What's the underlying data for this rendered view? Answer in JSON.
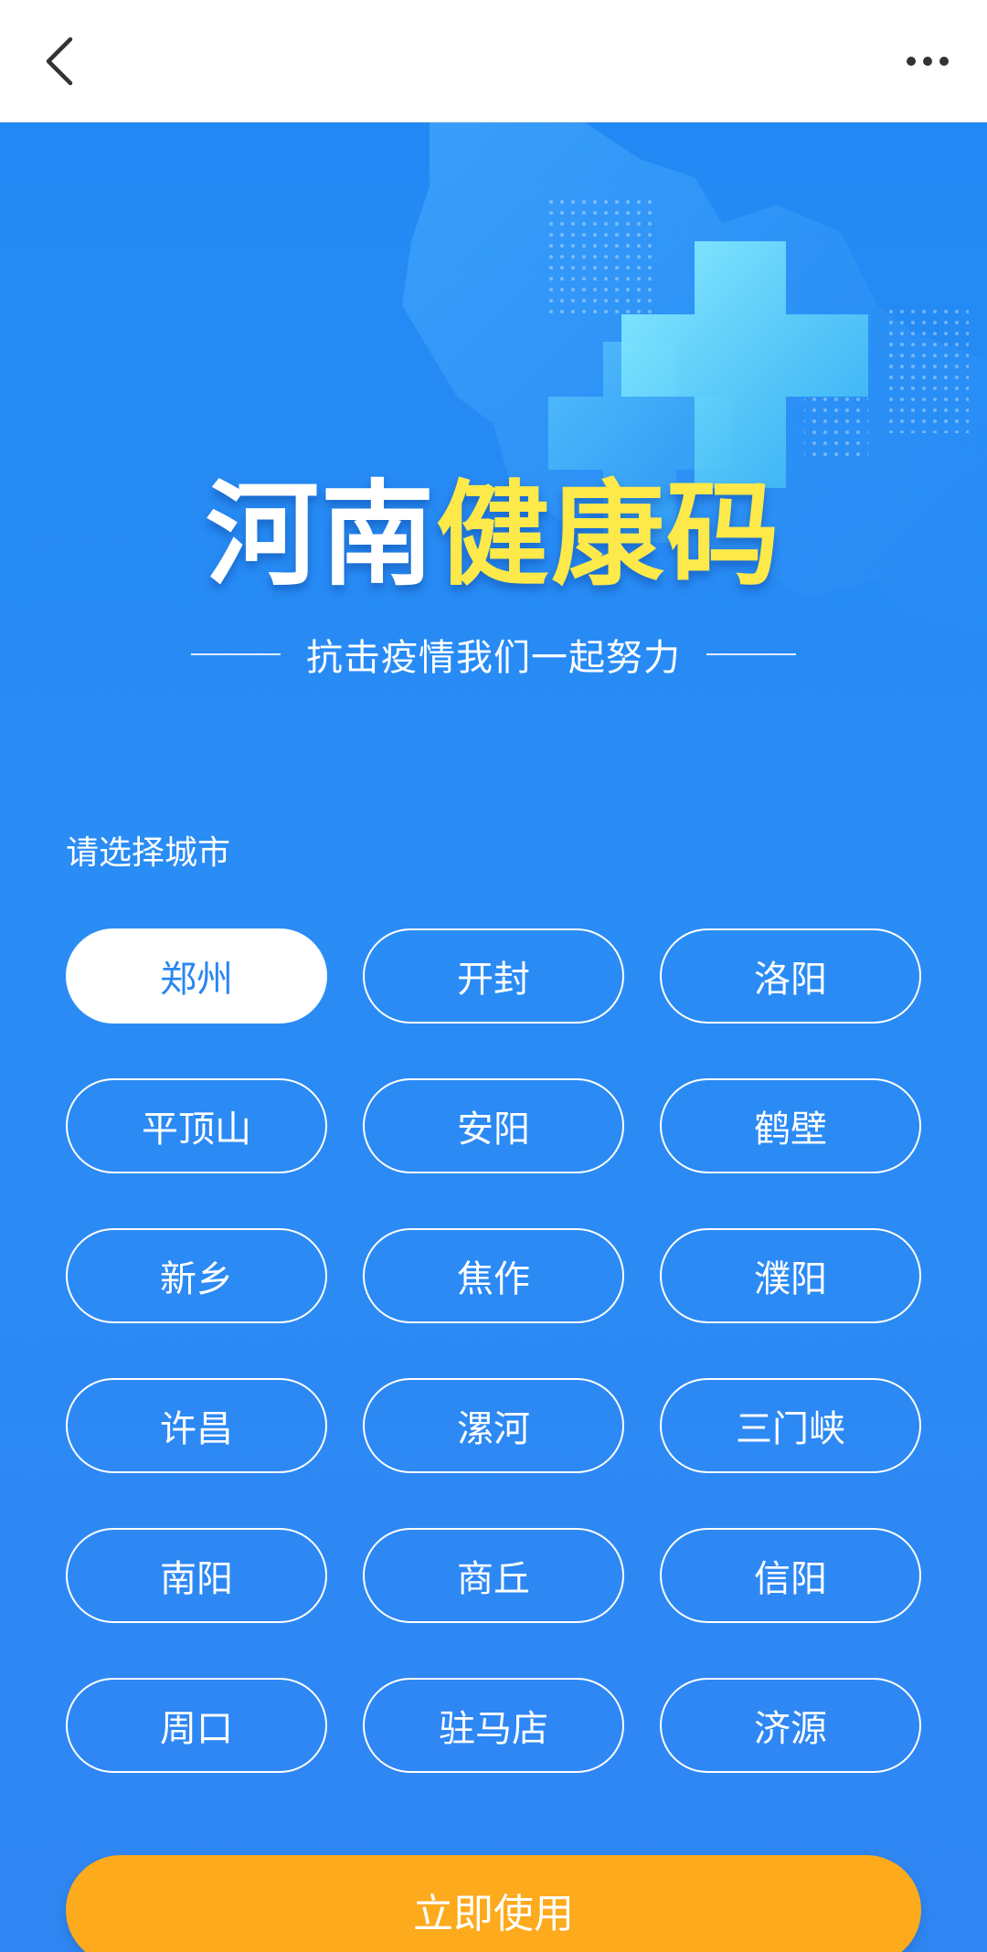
{
  "header": {
    "back_icon": "chevron-left-icon",
    "more_icon": "more-horizontal-icon"
  },
  "hero": {
    "title_white": "河南",
    "title_yellow": "健康码",
    "subtitle": "抗击疫情我们一起努力",
    "accent_yellow": "#fde94a",
    "background_blue": "#2a8cf5"
  },
  "city_section": {
    "label": "请选择城市",
    "selected": "郑州",
    "cities": [
      "郑州",
      "开封",
      "洛阳",
      "平顶山",
      "安阳",
      "鹤壁",
      "新乡",
      "焦作",
      "濮阳",
      "许昌",
      "漯河",
      "三门峡",
      "南阳",
      "商丘",
      "信阳",
      "周口",
      "驻马店",
      "济源"
    ]
  },
  "action": {
    "use_label": "立即使用",
    "button_color": "#fdaa1c"
  }
}
